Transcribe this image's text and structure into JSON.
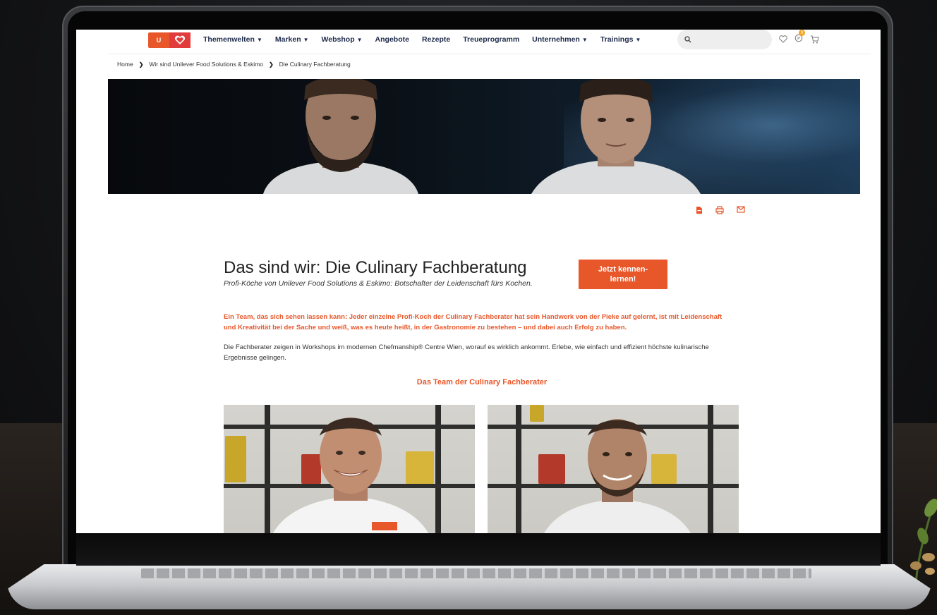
{
  "nav": {
    "logo_text": "U",
    "menu": [
      {
        "label": "Themenwelten",
        "dropdown": true
      },
      {
        "label": "Marken",
        "dropdown": true
      },
      {
        "label": "Webshop",
        "dropdown": true
      },
      {
        "label": "Angebote",
        "dropdown": false
      },
      {
        "label": "Rezepte",
        "dropdown": false
      },
      {
        "label": "Treueprogramm",
        "dropdown": false
      },
      {
        "label": "Unternehmen",
        "dropdown": true
      },
      {
        "label": "Trainings",
        "dropdown": true
      }
    ],
    "search_placeholder": "",
    "cart_badge": "0",
    "icons": [
      "search-icon",
      "heart-icon",
      "points-icon",
      "cart-icon"
    ]
  },
  "breadcrumb": {
    "items": [
      "Home",
      "Wir sind Unilever Food Solutions & Eskimo",
      "Die Culinary Fachberatung"
    ],
    "separator": "❯"
  },
  "share": {
    "icons": [
      "pdf-icon",
      "print-icon",
      "mail-icon"
    ]
  },
  "content": {
    "title": "Das sind wir: Die Culinary Fachberatung",
    "subtitle": "Profi-Köche von Unilever Food Solutions & Eskimo: Botschafter der Leidenschaft fürs Kochen.",
    "cta_label": "Jetzt kennen-lernen!",
    "lead": "Ein Team, das sich sehen lassen kann: Jeder einzelne Profi-Koch der Culinary Fachberater hat sein Handwerk von der Pieke auf gelernt, ist mit Leidenschaft und Kreativität bei der Sache und weiß, was es heute heißt, in der Gastronomie zu bestehen – und dabei auch Erfolg zu haben.",
    "body": "Die Fachberater zeigen in Workshops im modernen Chefmanship® Centre Wien, worauf es wirklich ankommt. Erlebe, wie einfach und effizient höchste kulinarische Ergebnisse gelingen.",
    "team_heading": "Das Team der Culinary Fachberater"
  },
  "colors": {
    "accent": "#e8572a",
    "nav_text": "#1e2a4a",
    "search_bg": "#eeeeee"
  }
}
